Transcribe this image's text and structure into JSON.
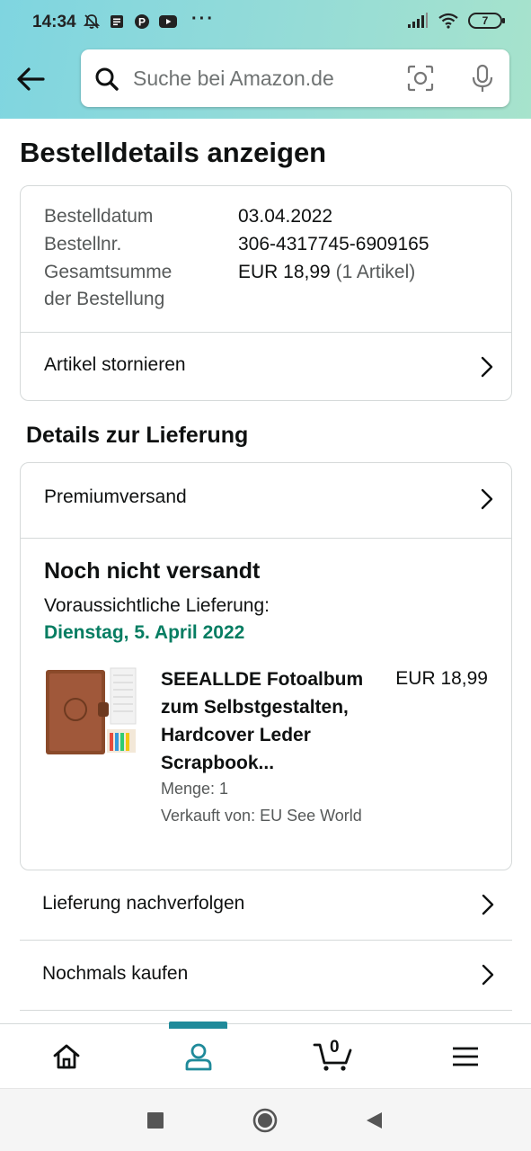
{
  "status_bar": {
    "time": "14:34",
    "dots": "···",
    "battery": "7"
  },
  "search": {
    "placeholder": "Suche bei Amazon.de"
  },
  "page": {
    "title": "Bestelldetails anzeigen"
  },
  "order_summary": {
    "rows": [
      {
        "label": "Bestelldatum",
        "value": "03.04.2022"
      },
      {
        "label": "Bestellnr.",
        "value": "306-4317745-6909165"
      },
      {
        "label_line1": "Gesamtsumme",
        "label_line2": "der Bestellung",
        "value": "EUR 18,99",
        "value_extra": "(1 Artikel)"
      }
    ],
    "cancel_label": "Artikel stornieren"
  },
  "delivery": {
    "section_title": "Details zur Lieferung",
    "shipping_method": "Premiumversand",
    "status": "Noch nicht versandt",
    "expected_label": "Voraussichtliche Lieferung:",
    "expected_date": "Dienstag, 5. April 2022",
    "product": {
      "title": "SEEALLDE Fotoalbum zum Selbstgestalten, Hardcover Leder Scrapbook...",
      "price": "EUR 18,99",
      "quantity": "Menge: 1",
      "seller": "Verkauft von: EU See World"
    }
  },
  "actions": [
    {
      "label": "Lieferung nachverfolgen"
    },
    {
      "label": "Nochmals kaufen"
    }
  ],
  "bottom_nav": {
    "items": [
      "home-icon",
      "account-icon",
      "cart-icon",
      "menu-icon"
    ],
    "cart_count": "0",
    "active_index": 1,
    "accent_color": "#1f8a9a"
  },
  "colors": {
    "delivery_green": "#067d62",
    "muted_text": "#565959"
  }
}
